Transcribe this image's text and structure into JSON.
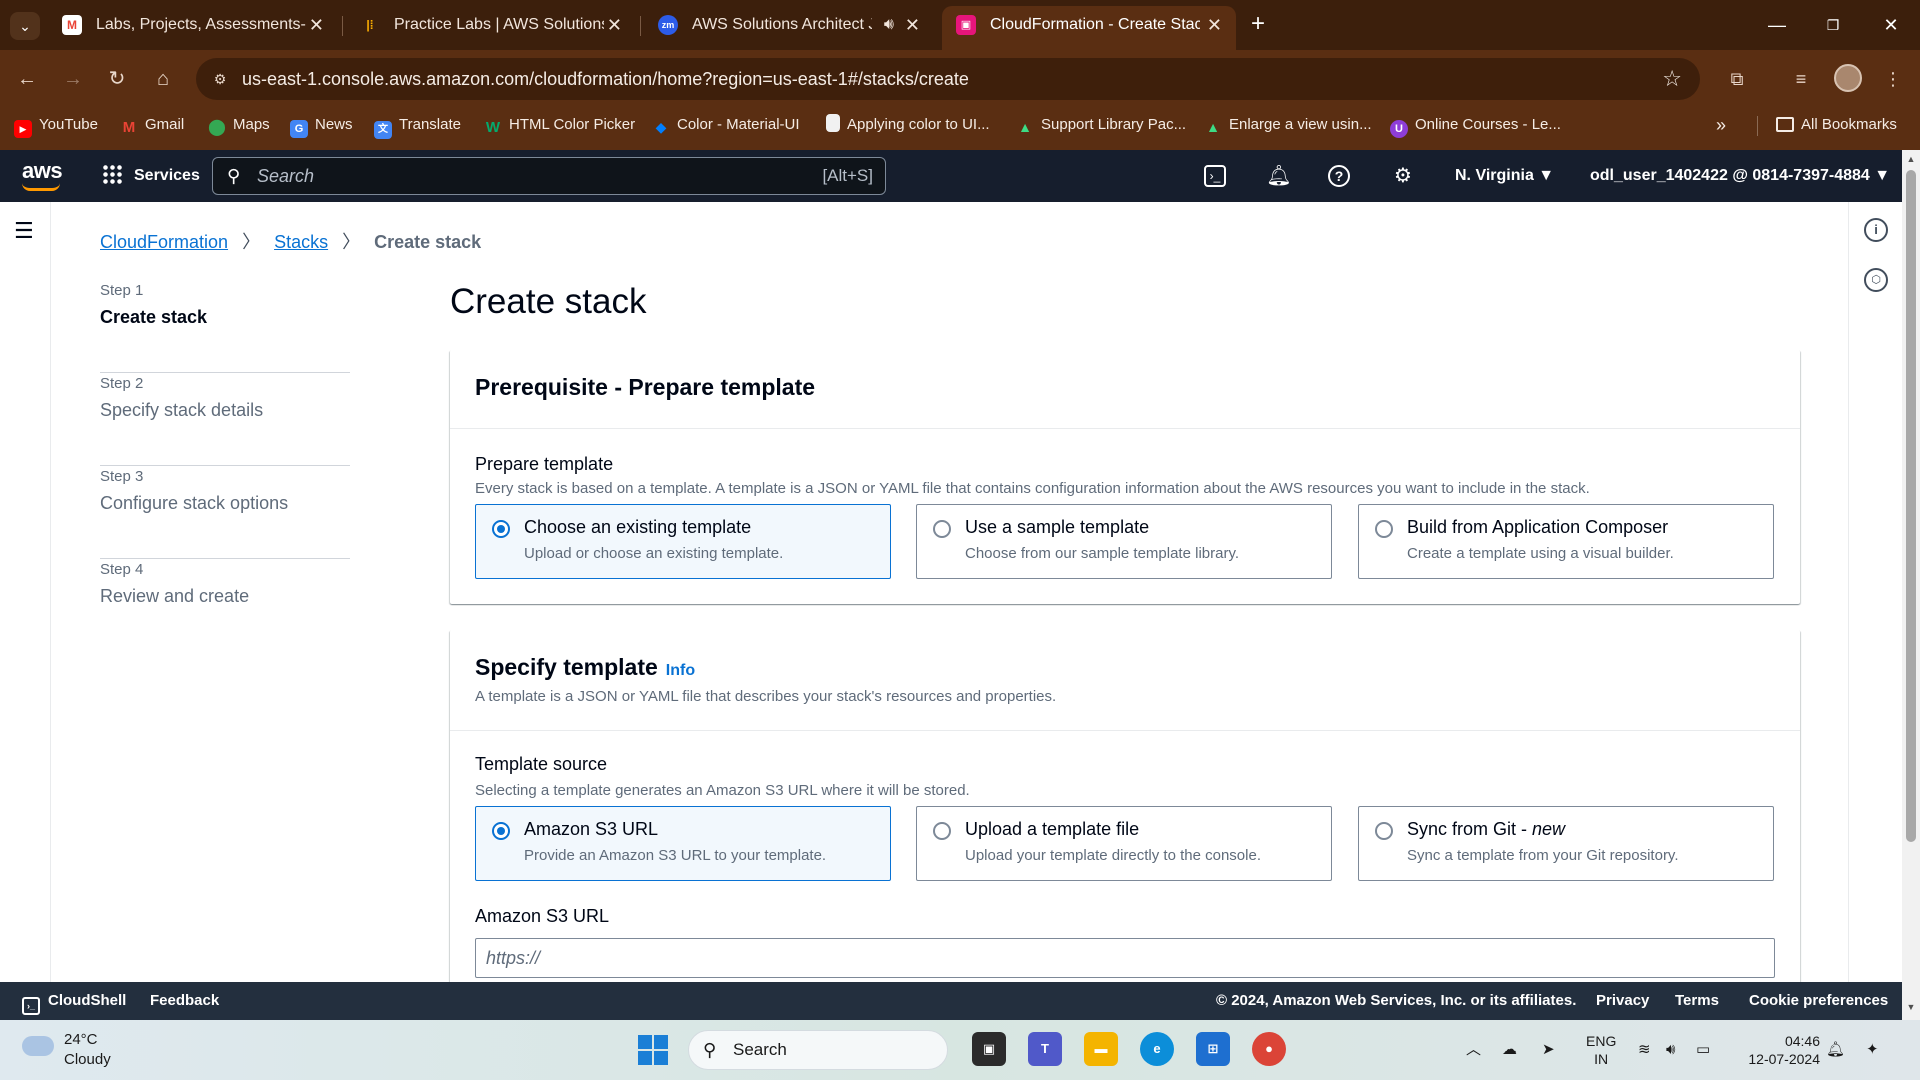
{
  "browser": {
    "tabs": [
      {
        "title": "Labs, Projects, Assessments-Lab",
        "icon": "gmail-icon",
        "color": "#ea4335",
        "glyph": "M"
      },
      {
        "title": "Practice Labs | AWS Solutions A",
        "icon": "practice-labs-icon",
        "color": "#ffb000",
        "glyph": "|"
      },
      {
        "title": "AWS Solutions Architect JU",
        "icon": "zoom-icon",
        "color": "#2d5ce8",
        "glyph": "zm"
      },
      {
        "title": "CloudFormation - Create Stack",
        "icon": "cloudformation-icon",
        "color": "#e7157b",
        "glyph": "▣"
      }
    ],
    "url": "us-east-1.console.aws.amazon.com/cloudformation/home?region=us-east-1#/stacks/create",
    "bookmarks": [
      {
        "label": "YouTube",
        "icon": "youtube-icon",
        "color": "#ff0000",
        "glyph": "▶"
      },
      {
        "label": "Gmail",
        "icon": "gmail-icon",
        "color": "#ea4335",
        "glyph": "M"
      },
      {
        "label": "Maps",
        "icon": "maps-icon",
        "color": "#34a853",
        "glyph": "●"
      },
      {
        "label": "News",
        "icon": "news-icon",
        "color": "#4285f4",
        "glyph": "G"
      },
      {
        "label": "Translate",
        "icon": "translate-icon",
        "color": "#4285f4",
        "glyph": "文"
      },
      {
        "label": "HTML Color Picker",
        "icon": "w3schools-icon",
        "color": "#04aa6d",
        "glyph": "W"
      },
      {
        "label": "Color - Material-UI",
        "icon": "mui-icon",
        "color": "#007fff",
        "glyph": "◆"
      },
      {
        "label": "Applying color to UI...",
        "icon": "page-icon",
        "color": "#f1f1f1",
        "glyph": ""
      },
      {
        "label": "Support Library Pac...",
        "icon": "android-icon",
        "color": "#3ddc84",
        "glyph": "▲"
      },
      {
        "label": "Enlarge a view usin...",
        "icon": "android-icon",
        "color": "#3ddc84",
        "glyph": "▲"
      },
      {
        "label": "Online Courses - Le...",
        "icon": "courses-icon",
        "color": "#8e3dd8",
        "glyph": "U"
      }
    ],
    "all_bookmarks": "All Bookmarks"
  },
  "aws": {
    "logo": "aws",
    "services": "Services",
    "search_placeholder": "Search",
    "search_shortcut": "[Alt+S]",
    "region": "N. Virginia ▼",
    "account": "odl_user_1402422 @ 0814-7397-4884 ▼"
  },
  "breadcrumb": {
    "root": "CloudFormation",
    "stacks": "Stacks",
    "current": "Create stack"
  },
  "steps": [
    {
      "num": "Step 1",
      "name": "Create stack"
    },
    {
      "num": "Step 2",
      "name": "Specify stack details"
    },
    {
      "num": "Step 3",
      "name": "Configure stack options"
    },
    {
      "num": "Step 4",
      "name": "Review and create"
    }
  ],
  "page_title": "Create stack",
  "prerequisite": {
    "title": "Prerequisite - Prepare template",
    "label": "Prepare template",
    "description": "Every stack is based on a template. A template is a JSON or YAML file that contains configuration information about the AWS resources you want to include in the stack.",
    "options": [
      {
        "label": "Choose an existing template",
        "desc": "Upload or choose an existing template."
      },
      {
        "label": "Use a sample template",
        "desc": "Choose from our sample template library."
      },
      {
        "label": "Build from Application Composer",
        "desc": "Create a template using a visual builder."
      }
    ],
    "selected_index": 0
  },
  "specify": {
    "title": "Specify template",
    "info": "Info",
    "description": "A template is a JSON or YAML file that describes your stack's resources and properties.",
    "source_label": "Template source",
    "source_desc": "Selecting a template generates an Amazon S3 URL where it will be stored.",
    "options": [
      {
        "label": "Amazon S3 URL",
        "desc": "Provide an Amazon S3 URL to your template."
      },
      {
        "label": "Upload a template file",
        "desc": "Upload your template directly to the console."
      },
      {
        "label": "Sync from Git - ",
        "label_em": "new",
        "desc": "Sync a template from your Git repository."
      }
    ],
    "selected_index": 0,
    "s3_label": "Amazon S3 URL",
    "s3_placeholder": "https://",
    "s3_value": ""
  },
  "footer": {
    "cloudshell": "CloudShell",
    "feedback": "Feedback",
    "copyright": "© 2024, Amazon Web Services, Inc. or its affiliates.",
    "privacy": "Privacy",
    "terms": "Terms",
    "cookies": "Cookie preferences"
  },
  "taskbar": {
    "temp": "24°C",
    "weather": "Cloudy",
    "search": "Search",
    "lang_top": "ENG",
    "lang_bottom": "IN",
    "time": "04:46",
    "date": "12-07-2024"
  }
}
